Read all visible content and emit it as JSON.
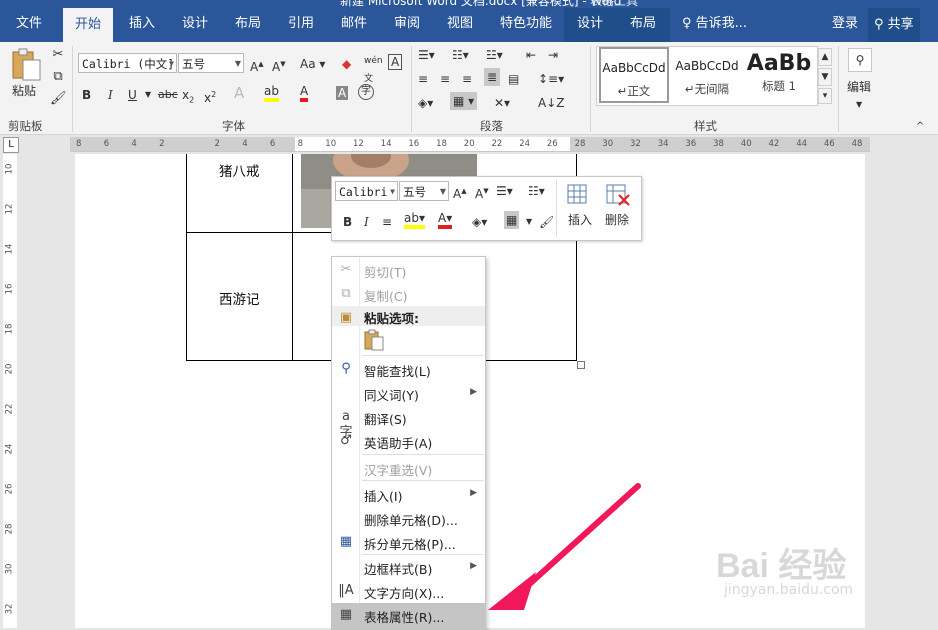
{
  "window": {
    "title": "新建 Microsoft Word 文档.docx [兼容模式] - Word",
    "context_title": "表格工具"
  },
  "tabs": [
    "文件",
    "开始",
    "插入",
    "设计",
    "布局",
    "引用",
    "邮件",
    "审阅",
    "视图",
    "特色功能",
    "设计",
    "布局"
  ],
  "tell_me": "告诉我...",
  "login": "登录",
  "share": "共享",
  "ribbon": {
    "paste": "粘贴",
    "font_name": "Calibri (中文]",
    "font_size": "五号",
    "bold": "B",
    "italic": "I",
    "underline": "U",
    "style1_preview": "AaBbCcDd",
    "style1": "正文",
    "style2_preview": "AaBbCcDd",
    "style2": "无间隔",
    "style3_preview": "AaBb",
    "style3": "标题 1",
    "editing": "编辑",
    "groups": [
      "剪贴板",
      "字体",
      "段落",
      "样式"
    ]
  },
  "ruler": {
    "h_ticks": [
      "8",
      "6",
      "4",
      "2",
      "",
      "2",
      "4",
      "6",
      "8",
      "10",
      "12",
      "14",
      "16",
      "18",
      "20",
      "22",
      "24",
      "26",
      "28",
      "30",
      "32",
      "34",
      "36",
      "38",
      "40",
      "42",
      "44",
      "46",
      "48"
    ],
    "v_ticks": [
      "10",
      "12",
      "14",
      "16",
      "18",
      "20",
      "22",
      "24",
      "26",
      "28",
      "30",
      "32"
    ]
  },
  "table": {
    "row1": "猪八戒",
    "row2": "西游记"
  },
  "mini_toolbar": {
    "font": "Calibri",
    "size": "五号",
    "bold": "B",
    "italic": "I",
    "insert": "插入",
    "delete": "删除"
  },
  "context_menu": [
    {
      "label": "剪切(T)",
      "icon": "scissors-icon",
      "disabled": true
    },
    {
      "label": "复制(C)",
      "icon": "copy-icon",
      "disabled": true
    },
    {
      "label": "粘贴选项:",
      "icon": "paste-icon",
      "header": true
    },
    {
      "label": "智能查找(L)",
      "icon": "smart-lookup-icon"
    },
    {
      "label": "同义词(Y)",
      "submenu": true
    },
    {
      "label": "翻译(S)",
      "icon": "translate-icon"
    },
    {
      "label": "英语助手(A)",
      "icon": "english-assistant-icon"
    },
    {
      "label": "汉字重选(V)",
      "disabled": true
    },
    {
      "label": "插入(I)",
      "submenu": true
    },
    {
      "label": "删除单元格(D)..."
    },
    {
      "label": "拆分单元格(P)...",
      "icon": "split-cells-icon"
    },
    {
      "label": "边框样式(B)",
      "submenu": true
    },
    {
      "label": "文字方向(X)...",
      "icon": "text-direction-icon"
    },
    {
      "label": "表格属性(R)...",
      "icon": "table-properties-icon",
      "highlighted": true
    }
  ],
  "watermark": {
    "brand": "Bai 经验",
    "url": "jingyan.baidu.com"
  },
  "colors": {
    "word_blue": "#2b579a",
    "arrow": "#f0185a",
    "menu_highlight": "#c5c5c5"
  }
}
